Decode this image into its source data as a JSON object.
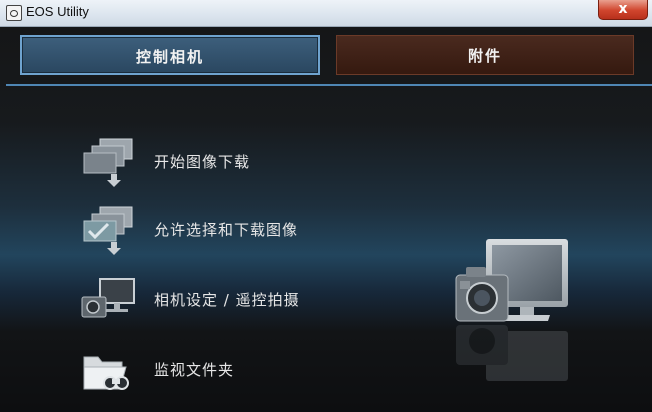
{
  "window": {
    "title": "EOS Utility",
    "close_label": "x"
  },
  "tabs": [
    {
      "label": "控制相机",
      "selected": true
    },
    {
      "label": "附件",
      "selected": false
    }
  ],
  "menu": [
    {
      "label": "开始图像下载",
      "icon": "download-images-icon"
    },
    {
      "label": "允许选择和下载图像",
      "icon": "select-download-icon"
    },
    {
      "label": "相机设定 / 遥控拍摄",
      "icon": "camera-monitor-icon"
    },
    {
      "label": "监视文件夹",
      "icon": "watch-folder-icon"
    }
  ],
  "colors": {
    "tab_selected": "#2f4d68",
    "tab_selected_border": "#6fa3cf",
    "tab_unselected": "#3e2216",
    "divider": "#4f86b4"
  }
}
